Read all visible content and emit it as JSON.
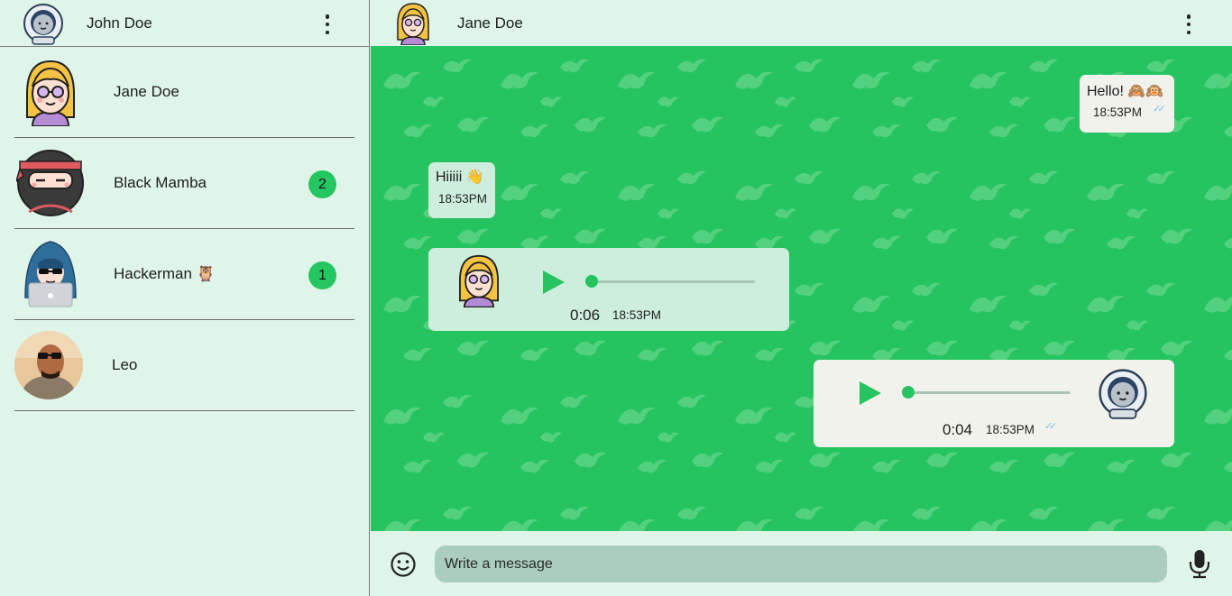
{
  "me": {
    "name": "John Doe",
    "avatar_icon": "astronaut-avatar-icon"
  },
  "contacts": [
    {
      "name": "Jane Doe",
      "avatar_icon": "blonde-girl-avatar-icon",
      "unread": ""
    },
    {
      "name": "Black Mamba",
      "avatar_icon": "ninja-avatar-icon",
      "unread": "2"
    },
    {
      "name": "Hackerman 🦉",
      "avatar_icon": "hacker-avatar-icon",
      "unread": "1"
    },
    {
      "name": "Leo",
      "avatar_icon": "photo-avatar-icon",
      "unread": ""
    }
  ],
  "chat": {
    "peer_name": "Jane Doe",
    "messages": [
      {
        "direction": "out",
        "type": "text",
        "text": "Hello! 🙈🙉",
        "time": "18:53PM",
        "read": true
      },
      {
        "direction": "in",
        "type": "text",
        "text": "Hiiiii 👋",
        "time": "18:53PM"
      },
      {
        "direction": "in",
        "type": "audio",
        "duration": "0:06",
        "time": "18:53PM",
        "progress": 0
      },
      {
        "direction": "out",
        "type": "audio",
        "duration": "0:04",
        "time": "18:53PM",
        "progress": 0,
        "read": true
      }
    ]
  },
  "composer": {
    "placeholder": "Write a message"
  },
  "colors": {
    "accent": "#25c460",
    "panel": "#dff5ea",
    "bubble_out": "#f2f2ec",
    "bubble_in": "#cdeedd",
    "input": "#aacdbd"
  }
}
